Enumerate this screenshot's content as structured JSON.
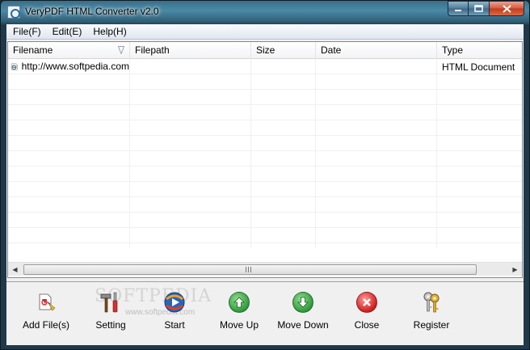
{
  "window": {
    "title": "VeryPDF HTML Converter v2.0"
  },
  "menu": [
    {
      "label": "File(F)"
    },
    {
      "label": "Edit(E)"
    },
    {
      "label": "Help(H)"
    }
  ],
  "list": {
    "columns": [
      "Filename",
      "Filepath",
      "Size",
      "Date",
      "Type"
    ],
    "rows": [
      {
        "filename": "http://www.softpedia.com",
        "filepath": "",
        "size": "",
        "date": "",
        "type": "HTML Document",
        "icon": "ie-document-icon"
      }
    ]
  },
  "toolbar": {
    "add_files": "Add File(s)",
    "setting": "Setting",
    "start": "Start",
    "move_up": "Move Up",
    "move_down": "Move Down",
    "close": "Close",
    "register": "Register"
  },
  "watermark": {
    "brand": "SOFTPEDIA",
    "url": "www.softpedia.com"
  },
  "colors": {
    "move_green": "#2f9a3c",
    "close_red": "#d21d1d",
    "title_glass": "#3a6f88"
  }
}
